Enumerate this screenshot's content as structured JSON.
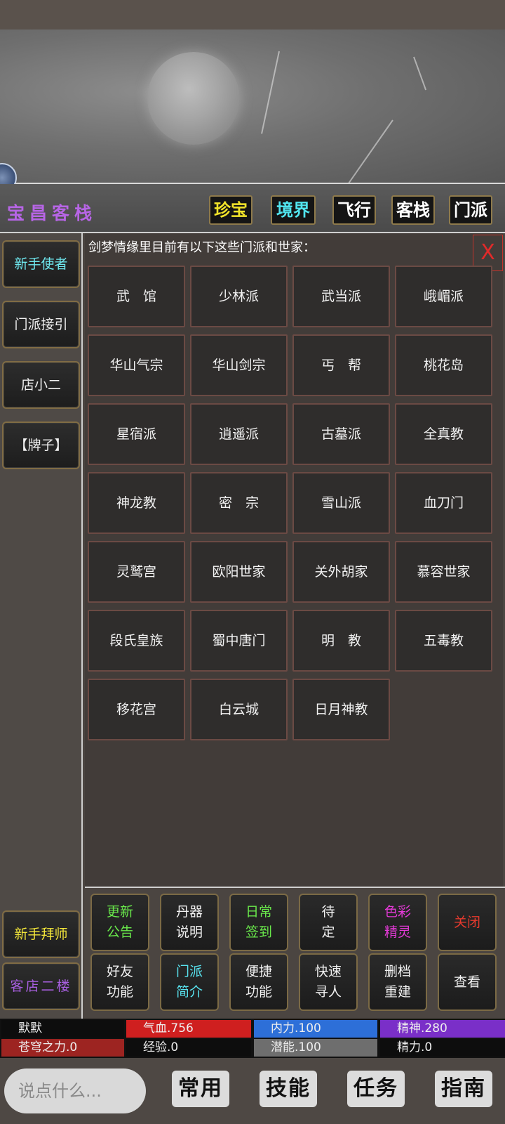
{
  "header": {
    "inn_name": "宝昌客栈",
    "tabs": [
      {
        "label": "珍宝"
      },
      {
        "label": "境界"
      },
      {
        "label": "飞行"
      },
      {
        "label": "客栈"
      },
      {
        "label": "门派"
      }
    ]
  },
  "sidebar": {
    "top_items": [
      {
        "label": "新手使者"
      },
      {
        "label": "门派接引"
      },
      {
        "label": "店小二"
      },
      {
        "label": "【牌子】"
      }
    ],
    "bottom_items": [
      {
        "label": "新手拜师"
      },
      {
        "label": "客店二楼"
      }
    ]
  },
  "panel": {
    "heading": "剑梦情缘里目前有以下这些门派和世家：",
    "close_label": "X",
    "sects": [
      "武　馆",
      "少林派",
      "武当派",
      "峨嵋派",
      "华山气宗",
      "华山剑宗",
      "丐　帮",
      "桃花岛",
      "星宿派",
      "逍遥派",
      "古墓派",
      "全真教",
      "神龙教",
      "密　宗",
      "雪山派",
      "血刀门",
      "灵鹫宫",
      "欧阳世家",
      "关外胡家",
      "慕容世家",
      "段氏皇族",
      "蜀中唐门",
      "明　教",
      "五毒教",
      "移花宫",
      "白云城",
      "日月神教"
    ]
  },
  "actions": [
    {
      "label": "更新\n公告"
    },
    {
      "label": "丹器\n说明"
    },
    {
      "label": "日常\n签到"
    },
    {
      "label": "待\n定"
    },
    {
      "label": "色彩\n精灵"
    },
    {
      "label": "关闭"
    },
    {
      "label": "好友\n功能"
    },
    {
      "label": "门派\n简介"
    },
    {
      "label": "便捷\n功能"
    },
    {
      "label": "快速\n寻人"
    },
    {
      "label": "删档\n重建"
    },
    {
      "label": "查看"
    }
  ],
  "stats": {
    "name": "默默",
    "hp": "气血.756",
    "neili": "内力.100",
    "jingshen": "精神.280",
    "cangqiong": "苍穹之力.0",
    "exp": "经验.0",
    "potential": "潜能.100",
    "jingli": "精力.0"
  },
  "colors": {
    "hp": "#cf1f1f",
    "neili": "#2d6fd8",
    "jingshen": "#7a2fc8",
    "cangqiong": "#9d2421",
    "potential": "#6e6e6e"
  },
  "bottom_nav": {
    "chat_placeholder": "说点什么...",
    "items": [
      {
        "label": "常用"
      },
      {
        "label": "技能"
      },
      {
        "label": "任务"
      },
      {
        "label": "指南"
      }
    ]
  }
}
